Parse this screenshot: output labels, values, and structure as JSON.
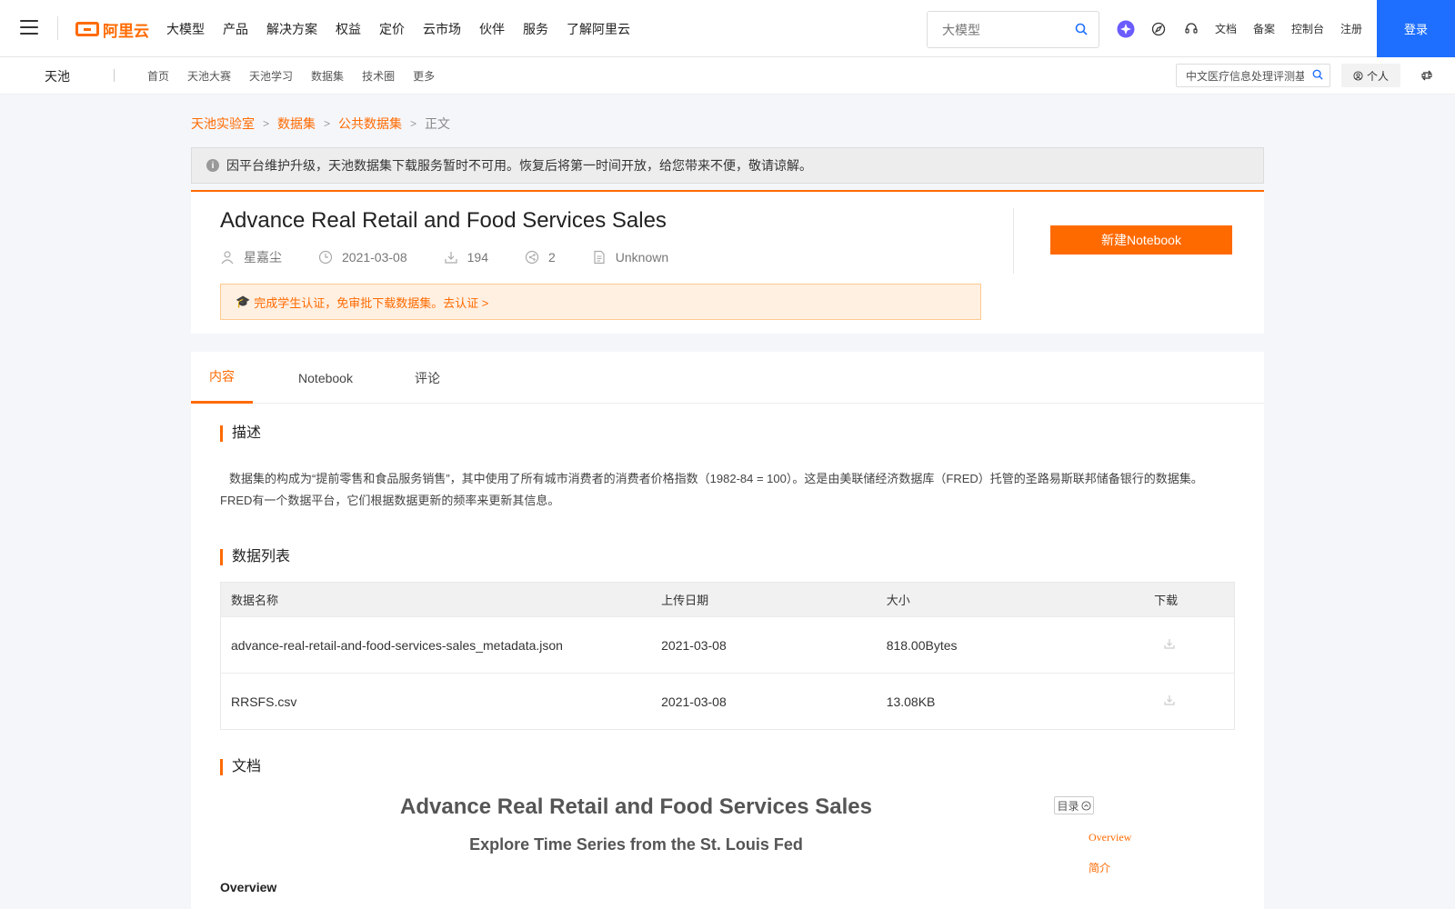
{
  "topnav": {
    "logo_text": "阿里云",
    "menu": [
      "大模型",
      "产品",
      "解决方案",
      "权益",
      "定价",
      "云市场",
      "伙伴",
      "服务",
      "了解阿里云"
    ],
    "search_placeholder": "大模型",
    "right_links": [
      "文档",
      "备案",
      "控制台",
      "注册"
    ],
    "login_label": "登录"
  },
  "subnav": {
    "brand": "天池",
    "links": [
      "首页",
      "天池大赛",
      "天池学习",
      "数据集",
      "技术圈",
      "更多"
    ],
    "search_value": "中文医疗信息处理评测基",
    "personal_label": "个人"
  },
  "breadcrumb": {
    "items": [
      "天池实验室",
      "数据集",
      "公共数据集"
    ],
    "current": "正文"
  },
  "notice": "因平台维护升级，天池数据集下载服务暂时不可用。恢复后将第一时间开放，给您带来不便，敬请谅解。",
  "dataset": {
    "title": "Advance Real Retail and Food Services Sales",
    "author": "星嘉尘",
    "date": "2021-03-08",
    "downloads": "194",
    "shares": "2",
    "license": "Unknown",
    "cert_text": "完成学生认证，免审批下载数据集。去认证 >",
    "new_notebook_label": "新建Notebook"
  },
  "tabs": [
    "内容",
    "Notebook",
    "评论"
  ],
  "sections": {
    "description_title": "描述",
    "description": "数据集的构成为“提前零售和食品服务销售”，其中使用了所有城市消费者的消费者价格指数（1982-84 = 100）。这是由美联储经济数据库（FRED）托管的圣路易斯联邦储备银行的数据集。FRED有一个数据平台，它们根据数据更新的频率来更新其信息。",
    "list_title": "数据列表",
    "doc_title": "文档"
  },
  "table": {
    "headers": [
      "数据名称",
      "上传日期",
      "大小",
      "下载"
    ],
    "rows": [
      {
        "name": "advance-real-retail-and-food-services-sales_metadata.json",
        "date": "2021-03-08",
        "size": "818.00Bytes"
      },
      {
        "name": "RRSFS.csv",
        "date": "2021-03-08",
        "size": "13.08KB"
      }
    ]
  },
  "doc": {
    "h1": "Advance Real Retail and Food Services Sales",
    "h3": "Explore Time Series from the St. Louis Fed",
    "h4": "Overview",
    "toc_label": "目录",
    "toc_items": [
      "Overview",
      "简介"
    ]
  },
  "colors": {
    "accent": "#ff6a00",
    "login": "#1e6fff"
  }
}
